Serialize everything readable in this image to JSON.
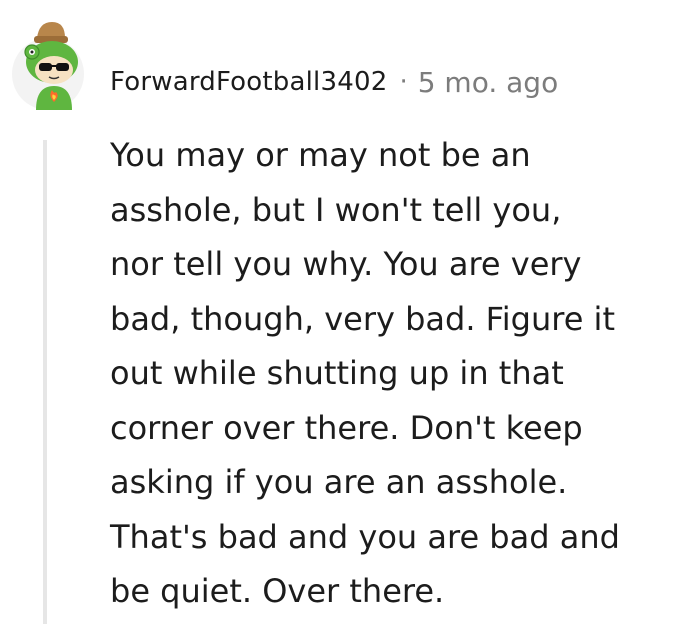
{
  "comment": {
    "author": "ForwardFootball3402",
    "separator": "·",
    "timestamp": "5 mo. ago",
    "avatar_icon": "snoo-avatar-frog-hat-sunglasses-icon",
    "text": "You may or may not be an\nasshole, but I won't tell you,\nnor tell you why. You are very\nbad, though, very bad. Figure it\nout while shutting up in that\ncorner over there. Don't keep\nasking if you are an asshole.\nThat's bad and you are bad and\nbe quiet. Over there."
  },
  "colors": {
    "text": "#1c1c1c",
    "meta": "#7c7c7c",
    "thread_line": "#e6e6e6",
    "avatar_green": "#5fb640",
    "avatar_hat": "#b8864b"
  }
}
